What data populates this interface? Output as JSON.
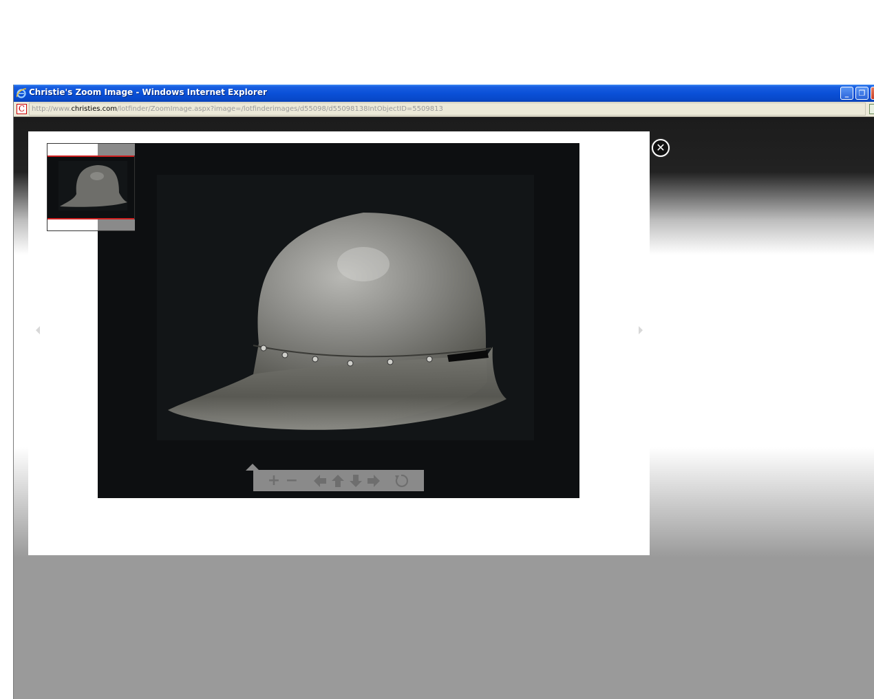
{
  "window": {
    "title": "Christie's Zoom Image - Windows Internet Explorer",
    "controls": {
      "minimize": "_",
      "restore": "❐",
      "close": "✕"
    }
  },
  "address_bar": {
    "site_icon_letter": "C",
    "url_prefix": "http://www.",
    "url_host": "christies.com",
    "url_path": "/lotfinder/ZoomImage.aspx?image=/lotfinderimages/d55098/d55098138IntObjectID=5509813"
  },
  "viewer": {
    "close_glyph": "✕",
    "image_subject": "steel helmet (sallet)",
    "prev_icon": "triangle-left-icon",
    "next_icon": "triangle-right-icon"
  },
  "toolbar": {
    "zoom_in": "+",
    "zoom_out": "−",
    "icons": [
      "plus-icon",
      "minus-icon",
      "arrow-left-icon",
      "arrow-up-icon",
      "arrow-down-icon",
      "arrow-right-icon",
      "reset-icon"
    ]
  },
  "colors": {
    "title_bar": "#0a50d8",
    "viewer_bg": "#0d0f11",
    "toolbar_bg": "#8a8a8a",
    "thumb_frame": "#d02020"
  }
}
